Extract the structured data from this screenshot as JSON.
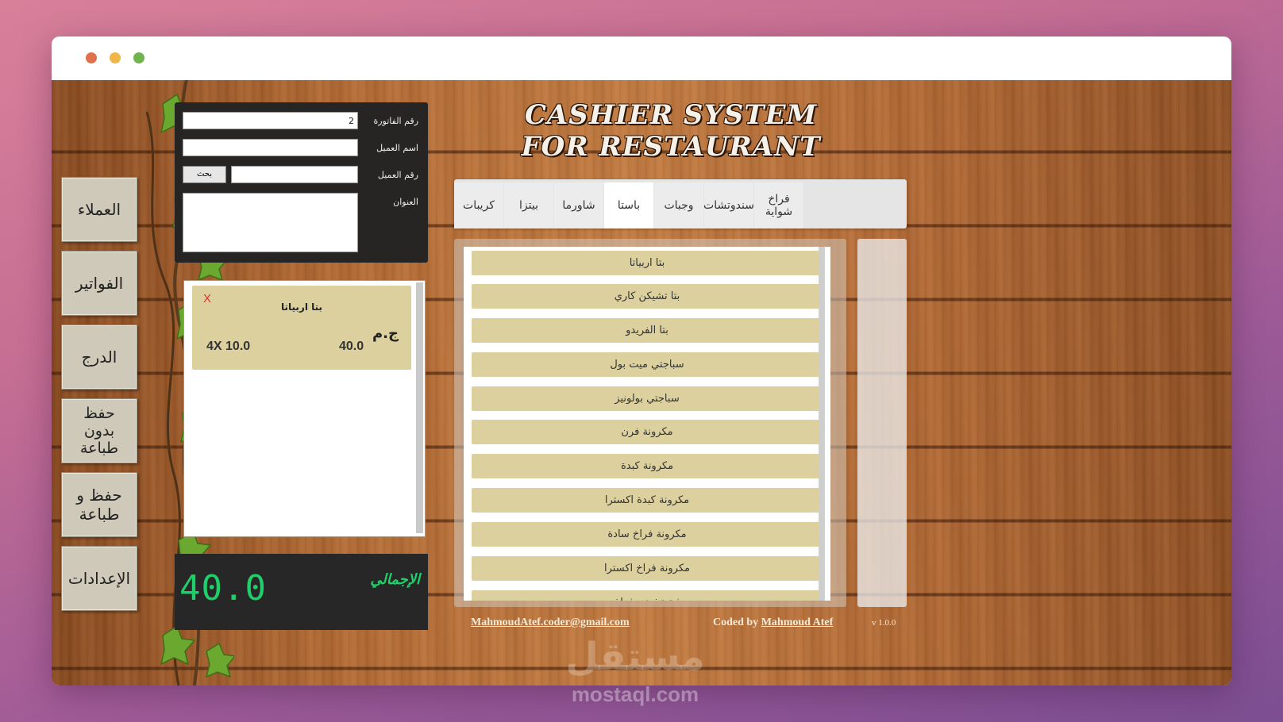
{
  "app_title": "CASHIER SYSTEM FOR RESTAURANT",
  "nav": [
    {
      "label": "العملاء"
    },
    {
      "label": "الفواتير"
    },
    {
      "label": "الدرج"
    },
    {
      "label": "حفظ\nبدون\nطباعة"
    },
    {
      "label": "حفظ و\nطباعة"
    },
    {
      "label": "الإعدادات"
    }
  ],
  "customer": {
    "invoice_label": "رقم الفاتورة",
    "invoice_value": "2",
    "name_label": "اسم العميل",
    "name_value": "",
    "number_label": "رقم العميل",
    "number_value": "",
    "search_label": "بحث",
    "address_label": "العنوان",
    "address_value": ""
  },
  "order": {
    "remove_label": "X",
    "item_name": "بتا اربياتا",
    "currency": "ج.م",
    "qty_price": "4X 10.0",
    "subtotal": "40.0"
  },
  "total": {
    "label": "الإجمالي",
    "value": "40.0"
  },
  "tabs": [
    {
      "label": "كريبات"
    },
    {
      "label": "بيتزا"
    },
    {
      "label": "شاورما"
    },
    {
      "label": "باستا",
      "active": true
    },
    {
      "label": "وجبات"
    },
    {
      "label": "سندوتشات"
    },
    {
      "label": "فراخ\nشواية"
    }
  ],
  "items": [
    "بتا اربياتا",
    "بتا تشيكن كاري",
    "بتا الفريدو",
    "سباجتي ميت بول",
    "سباجتي بولونيز",
    "مكرونة فرن",
    "مكرونة كبدة",
    "مكرونة كبدة اكسترا",
    "مكرونة فراخ سادة",
    "مكرونة فراخ اكسترا",
    "فيتوتشيني فراخ"
  ],
  "footer": {
    "email": "MahmoudAtef.coder@gmail.com",
    "coded_by": "Coded by",
    "author": "Mahmoud Atef",
    "version": "v 1.0.0"
  },
  "watermark": {
    "logo": "مستقل",
    "text": "mostaql.com"
  },
  "colors": {
    "item_button": "#ddd09f",
    "total_text": "#1fd06a",
    "panel_dark": "#262524"
  }
}
